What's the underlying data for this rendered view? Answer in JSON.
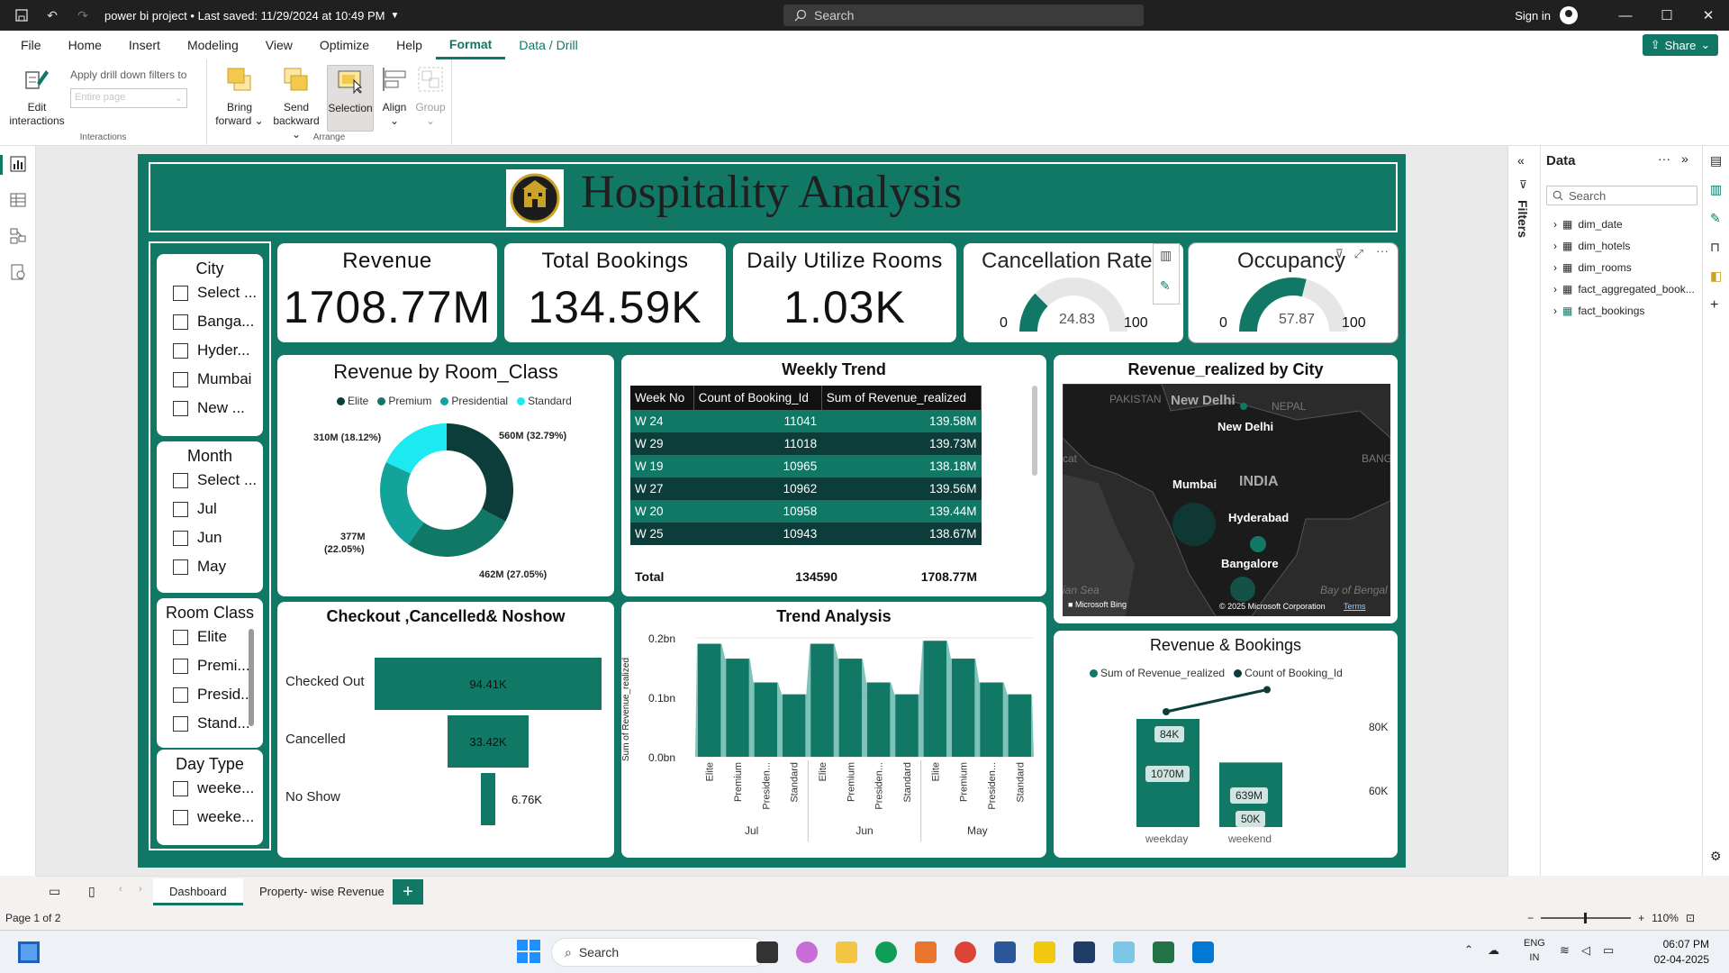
{
  "titlebar": {
    "file_title": "power bi project",
    "saved_text": "Last saved: 11/29/2024 at 10:49 PM",
    "search_placeholder": "Search",
    "signin_label": "Sign in"
  },
  "menu": {
    "items": [
      "File",
      "Home",
      "Insert",
      "Modeling",
      "View",
      "Optimize",
      "Help",
      "Format",
      "Data / Drill"
    ],
    "active": "Format",
    "share_label": "Share"
  },
  "ribbon": {
    "edit_interactions": [
      "Edit",
      "interactions"
    ],
    "drill_label": "Apply drill down filters to",
    "drill_placeholder": "Entire page",
    "interactions_group": "Interactions",
    "bring_forward": [
      "Bring",
      "forward"
    ],
    "send_backward": [
      "Send",
      "backward"
    ],
    "selection": "Selection",
    "align": "Align",
    "group": "Group",
    "arrange_group": "Arrange"
  },
  "report": {
    "title": "Hospitality Analysis",
    "slicers": {
      "city": {
        "title": "City",
        "items": [
          "Select ...",
          "Banga...",
          "Hyder...",
          "Mumbai",
          "New ..."
        ]
      },
      "month": {
        "title": "Month",
        "items": [
          "Select ...",
          "Jul",
          "Jun",
          "May"
        ]
      },
      "room_class": {
        "title": "Room Class",
        "items": [
          "Elite",
          "Premi...",
          "Presid...",
          "Stand..."
        ]
      },
      "day_type": {
        "title": "Day Type",
        "items": [
          "weeke...",
          "weeke..."
        ]
      }
    },
    "kpis": {
      "revenue": {
        "title": "Revenue",
        "value": "1708.77M"
      },
      "bookings": {
        "title": "Total Bookings",
        "value": "134.59K"
      },
      "rooms": {
        "title": "Daily Utilize Rooms",
        "value": "1.03K"
      }
    },
    "gauges": {
      "cancellation": {
        "title": "Cancellation Rate",
        "min": "0",
        "max": "100",
        "value": "24.83",
        "fraction": 0.2483
      },
      "occupancy": {
        "title": "Occupancy",
        "min": "0",
        "max": "100",
        "value": "57.87",
        "fraction": 0.5787
      }
    },
    "room_class_chart": {
      "title": "Revenue by Room_Class",
      "legend": [
        "Elite",
        "Premium",
        "Presidential",
        "Standard"
      ],
      "labels": {
        "elite": "560M (32.79%)",
        "premium": "462M (27.05%)",
        "presidential_a": "377M",
        "presidential_b": "(22.05%)",
        "standard": "310M (18.12%)"
      }
    },
    "weekly_trend": {
      "title": "Weekly Trend",
      "columns": [
        "Week No",
        "Count of Booking_Id",
        "Sum of Revenue_realized"
      ],
      "rows": [
        [
          "W 24",
          "11041",
          "139.58M"
        ],
        [
          "W 29",
          "11018",
          "139.73M"
        ],
        [
          "W 19",
          "10965",
          "138.18M"
        ],
        [
          "W 27",
          "10962",
          "139.56M"
        ],
        [
          "W 20",
          "10958",
          "139.44M"
        ],
        [
          "W 25",
          "10943",
          "138.67M"
        ]
      ],
      "total": [
        "Total",
        "134590",
        "1708.77M"
      ]
    },
    "city_map": {
      "title": "Revenue_realized by City",
      "cities": [
        "New Delhi",
        "Mumbai",
        "Hyderabad",
        "Bangalore"
      ],
      "geo_labels": [
        "PAKISTAN",
        "NEPAL",
        "INDIA",
        "BANGL",
        "Bay of Bengal",
        "ian Sea",
        "cat"
      ],
      "attribution": "© 2025 Microsoft Corporation",
      "terms": "Terms",
      "bing": "Microsoft Bing"
    },
    "funnel": {
      "title": "Checkout ,Cancelled& Noshow",
      "stages": [
        {
          "label": "Checked Out",
          "value": "94.41K"
        },
        {
          "label": "Cancelled",
          "value": "33.42K"
        },
        {
          "label": "No Show",
          "value": "6.76K"
        }
      ]
    },
    "trend_analysis": {
      "title": "Trend Analysis",
      "ylabel": "Sum of Revenue_realized",
      "ticks": [
        "0.2bn",
        "0.1bn",
        "0.0bn"
      ]
    },
    "rev_bookings": {
      "title": "Revenue & Bookings",
      "legend": [
        "Sum of Revenue_realized",
        "Count of Booking_Id"
      ],
      "right_ticks": [
        "80K",
        "60K"
      ],
      "labels": {
        "weekday_count": "84K",
        "weekday_rev": "1070M",
        "weekend_rev": "639M",
        "weekend_count": "50K"
      }
    }
  },
  "chart_data": [
    {
      "type": "bar",
      "title": "Trend Analysis",
      "ylabel": "Sum of Revenue_realized",
      "ylim": [
        0,
        0.2
      ],
      "groups": [
        "Jul",
        "Jun",
        "May"
      ],
      "categories": [
        "Elite",
        "Premium",
        "Presiden...",
        "Standard",
        "Elite",
        "Premium",
        "Presiden...",
        "Standard",
        "Elite",
        "Premium",
        "Presiden...",
        "Standard"
      ],
      "values": [
        0.19,
        0.165,
        0.125,
        0.105,
        0.19,
        0.165,
        0.125,
        0.105,
        0.195,
        0.165,
        0.125,
        0.105
      ]
    },
    {
      "type": "pie",
      "title": "Revenue by Room_Class",
      "categories": [
        "Elite",
        "Premium",
        "Presidential",
        "Standard"
      ],
      "values": [
        560,
        462,
        377,
        310
      ],
      "colors": [
        "#0d3d3a",
        "#117865",
        "#13a39a",
        "#1de9f0"
      ]
    },
    {
      "type": "bar",
      "title": "Revenue & Bookings",
      "categories": [
        "weekday",
        "weekend"
      ],
      "series": [
        {
          "name": "Sum of Revenue_realized",
          "values": [
            1070,
            639
          ]
        },
        {
          "name": "Count of Booking_Id",
          "values": [
            84,
            50
          ]
        }
      ]
    },
    {
      "type": "bar",
      "title": "Checkout ,Cancelled& Noshow",
      "categories": [
        "Checked Out",
        "Cancelled",
        "No Show"
      ],
      "values": [
        94.41,
        33.42,
        6.76
      ]
    }
  ],
  "data_pane": {
    "title": "Data",
    "search_placeholder": "Search",
    "tables": [
      "dim_date",
      "dim_hotels",
      "dim_rooms",
      "fact_aggregated_book...",
      "fact_bookings"
    ],
    "filters_label": "Filters"
  },
  "page_tabs": {
    "tabs": [
      "Dashboard",
      "Property- wise Revenue"
    ],
    "active": "Dashboard"
  },
  "status": {
    "page_label": "Page 1 of 2",
    "zoom": "110%"
  },
  "taskbar": {
    "search_placeholder": "Search",
    "lang_a": "ENG",
    "lang_b": "IN",
    "time": "06:07 PM",
    "date": "02-04-2025"
  },
  "colors": {
    "teal": "#117865",
    "dark_teal": "#0d3d3a",
    "cyan": "#1de9f0",
    "mid_teal": "#13a39a"
  }
}
